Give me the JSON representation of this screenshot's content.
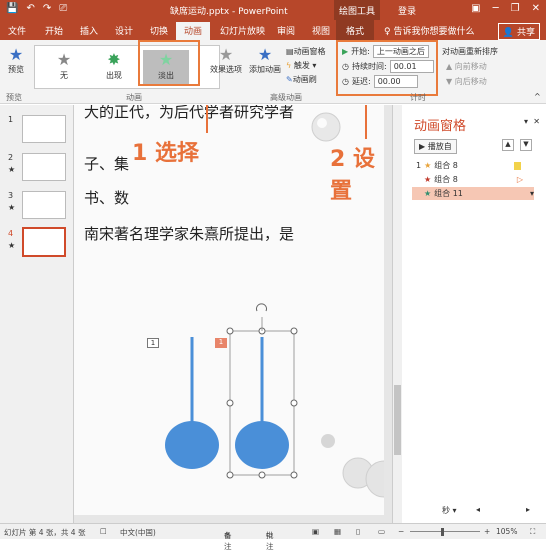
{
  "titlebar": {
    "doc_title": "缺席运动.pptx - PowerPoint",
    "context_tab_group": "绘图工具",
    "login": "登录",
    "qat_icons": [
      "save-icon",
      "undo-icon",
      "redo-icon",
      "start-from-beginning-icon"
    ],
    "window_icons": [
      "ribbon-display-icon",
      "minimize-icon",
      "restore-icon",
      "close-icon"
    ]
  },
  "tabs": [
    {
      "label": "文件"
    },
    {
      "label": "开始"
    },
    {
      "label": "插入"
    },
    {
      "label": "设计"
    },
    {
      "label": "切换"
    },
    {
      "label": "动画"
    },
    {
      "label": "幻灯片放映"
    },
    {
      "label": "审阅"
    },
    {
      "label": "视图"
    },
    {
      "label": "格式"
    }
  ],
  "tell_me": "告诉我你想要做什么",
  "share": "共享",
  "ribbon": {
    "preview": "预览",
    "preview_group": "预览",
    "gallery": [
      {
        "label": "无"
      },
      {
        "label": "出现"
      },
      {
        "label": "淡出"
      }
    ],
    "effect_options": "效果选项",
    "animation_group": "动画",
    "add_animation": "添加动画",
    "animation_pane": "动画窗格",
    "trigger": "触发",
    "animation_painter": "动画刷",
    "advanced_group": "高级动画",
    "start_label": "开始:",
    "start_value": "上一动画之后",
    "duration_label": "持续时间:",
    "duration_value": "00.01",
    "delay_label": "延迟:",
    "delay_value": "00.00",
    "reorder_title": "对动画重新排序",
    "move_earlier": "向前移动",
    "move_later": "向后移动",
    "timing_group": "计时"
  },
  "slides": [
    {
      "num": "1"
    },
    {
      "num": "2"
    },
    {
      "num": "3"
    },
    {
      "num": "4"
    }
  ],
  "slide_text": {
    "line1": "大的正代，为后代学者研究学者",
    "line2": "子、集",
    "line3": "书、数",
    "line4": "南宋著名理学家朱熹所提出，是"
  },
  "callouts": {
    "step1_num": "1",
    "step1_text": "选择",
    "step2_num": "2",
    "step2_text": "设置"
  },
  "anim_tags": {
    "tag1": "1",
    "tag2": "1"
  },
  "anim_pane": {
    "title": "动画窗格",
    "play_label": "播放自",
    "items": [
      {
        "num": "1",
        "label": "组合 8"
      },
      {
        "num": "",
        "label": "组合 8"
      },
      {
        "num": "",
        "label": "组合 11"
      }
    ],
    "seconds_label": "秒"
  },
  "status": {
    "slide_info": "幻灯片 第 4 张，共 4 张",
    "language": "中文(中国)",
    "notes": "备注",
    "comments": "批注",
    "zoom": "105%"
  },
  "colors": {
    "accent": "#b7472a",
    "callout": "#e8713a",
    "shape": "#4a8fd8"
  }
}
